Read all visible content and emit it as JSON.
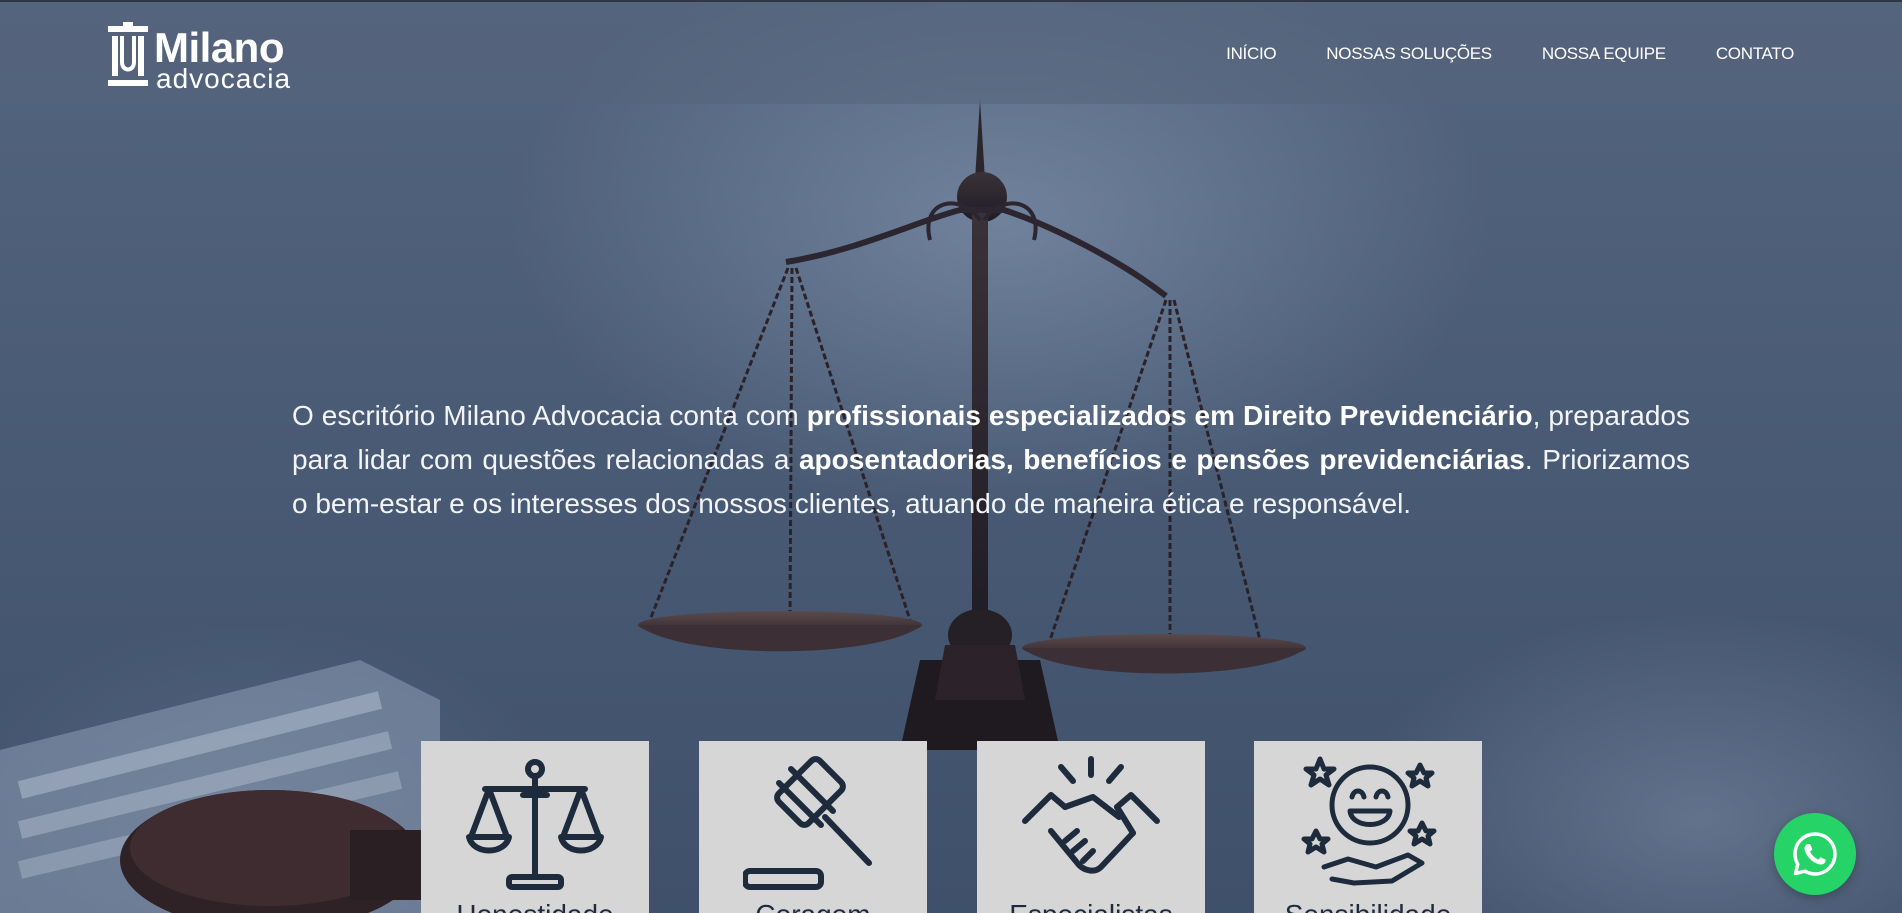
{
  "header": {
    "logo": {
      "name": "Milano",
      "sub": "advocacia"
    },
    "nav": [
      {
        "label": "INÍCIO"
      },
      {
        "label": "NOSSAS SOLUÇÕES"
      },
      {
        "label": "NOSSA EQUIPE"
      },
      {
        "label": "CONTATO"
      }
    ]
  },
  "intro": {
    "part1": "O escritório Milano Advocacia conta com ",
    "bold1": "profissionais especializados em Direito Previdenciário",
    "part2": ", preparados para lidar com questões relacionadas a ",
    "bold2": "aposentadorias, benefícios e pensões previdenciárias",
    "part3": ". Priorizamos o bem-estar e os interesses dos nossos clientes, atuando de maneira ética e responsável."
  },
  "cards": [
    {
      "label": "Honestidade",
      "icon": "scales-icon"
    },
    {
      "label": "Coragem",
      "icon": "gavel-icon"
    },
    {
      "label": "Especialistas",
      "icon": "handshake-icon"
    },
    {
      "label": "Sensibilidade",
      "icon": "smile-stars-icon"
    }
  ],
  "whatsapp": {
    "icon": "whatsapp-icon"
  },
  "colors": {
    "card_bg": "#d6d6d6",
    "icon_navy": "#1d2b3d",
    "whatsapp": "#25d366"
  }
}
